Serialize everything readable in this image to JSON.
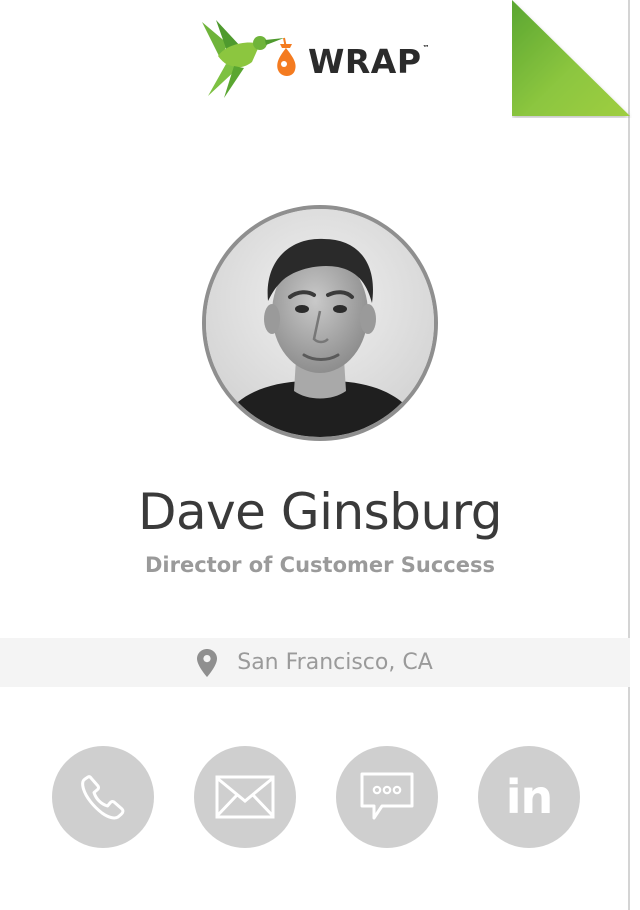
{
  "brand": {
    "logo_text": "WRAP",
    "trademark": "™",
    "logo_icon": "hummingbird-icon",
    "colors": {
      "green": "#7dc142",
      "dark_green": "#4f9a2e",
      "orange": "#f47b20",
      "text": "#2b2b2b"
    }
  },
  "profile": {
    "name": "Dave Ginsburg",
    "job_title": "Director of Customer Success",
    "photo_icon": "profile-photo"
  },
  "location": {
    "icon": "map-pin-icon",
    "text": "San Francisco, CA"
  },
  "actions": [
    {
      "id": "call",
      "icon": "phone-icon"
    },
    {
      "id": "email",
      "icon": "envelope-icon"
    },
    {
      "id": "message",
      "icon": "chat-bubble-icon"
    },
    {
      "id": "linkedin",
      "icon": "linkedin-icon",
      "glyph": "in"
    }
  ],
  "theme": {
    "button_gray": "#cfcfcf",
    "muted_text": "#9a9a9a",
    "location_bg": "#f4f4f4",
    "avatar_border": "#8f8f8f",
    "fold_green_light": "#9fce3f",
    "fold_green_dark": "#5aa631"
  }
}
